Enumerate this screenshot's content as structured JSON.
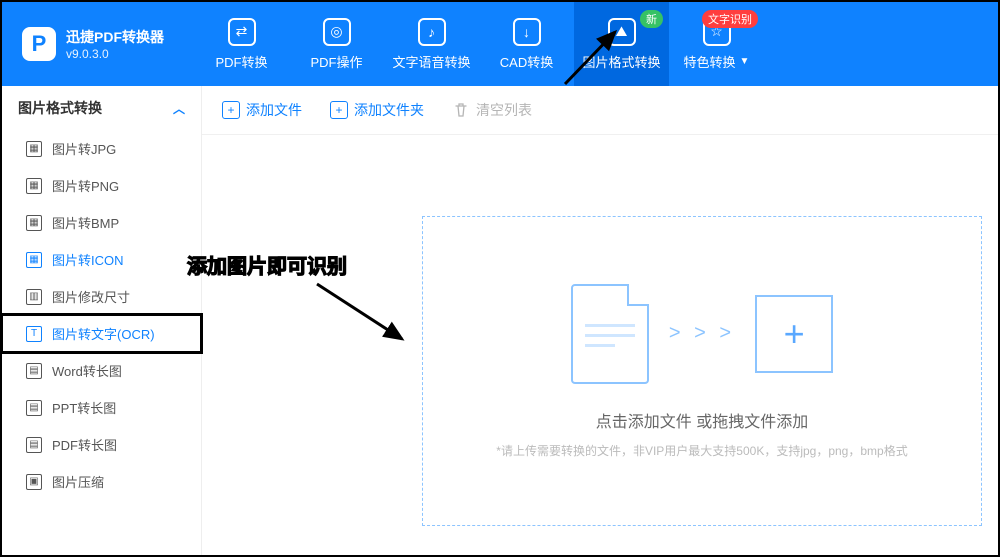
{
  "brand": {
    "title": "迅捷PDF转换器",
    "version": "v9.0.3.0"
  },
  "nav": {
    "items": [
      {
        "label": "PDF转换",
        "glyph": "⇄"
      },
      {
        "label": "PDF操作",
        "glyph": "◎"
      },
      {
        "label": "文字语音转换",
        "glyph": "♪"
      },
      {
        "label": "CAD转换",
        "glyph": "↓"
      },
      {
        "label": "图片格式转换",
        "glyph": "⛰"
      },
      {
        "label": "特色转换",
        "glyph": "☆"
      }
    ],
    "badge_new": "新",
    "badge_ocr": "文字识别"
  },
  "sidebar": {
    "title": "图片格式转换",
    "items": [
      {
        "label": "图片转JPG"
      },
      {
        "label": "图片转PNG"
      },
      {
        "label": "图片转BMP"
      },
      {
        "label": "图片转ICON"
      },
      {
        "label": "图片修改尺寸"
      },
      {
        "label": "图片转文字(OCR)"
      },
      {
        "label": "Word转长图"
      },
      {
        "label": "PPT转长图"
      },
      {
        "label": "PDF转长图"
      },
      {
        "label": "图片压缩"
      }
    ]
  },
  "toolbar": {
    "add_file": "添加文件",
    "add_folder": "添加文件夹",
    "clear_list": "清空列表"
  },
  "dropzone": {
    "arrows": "> > >",
    "title": "点击添加文件 或拖拽文件添加",
    "hint": "*请上传需要转换的文件，非VIP用户最大支持500K，支持jpg，png，bmp格式"
  },
  "annotation": {
    "text": "添加图片即可识别"
  }
}
